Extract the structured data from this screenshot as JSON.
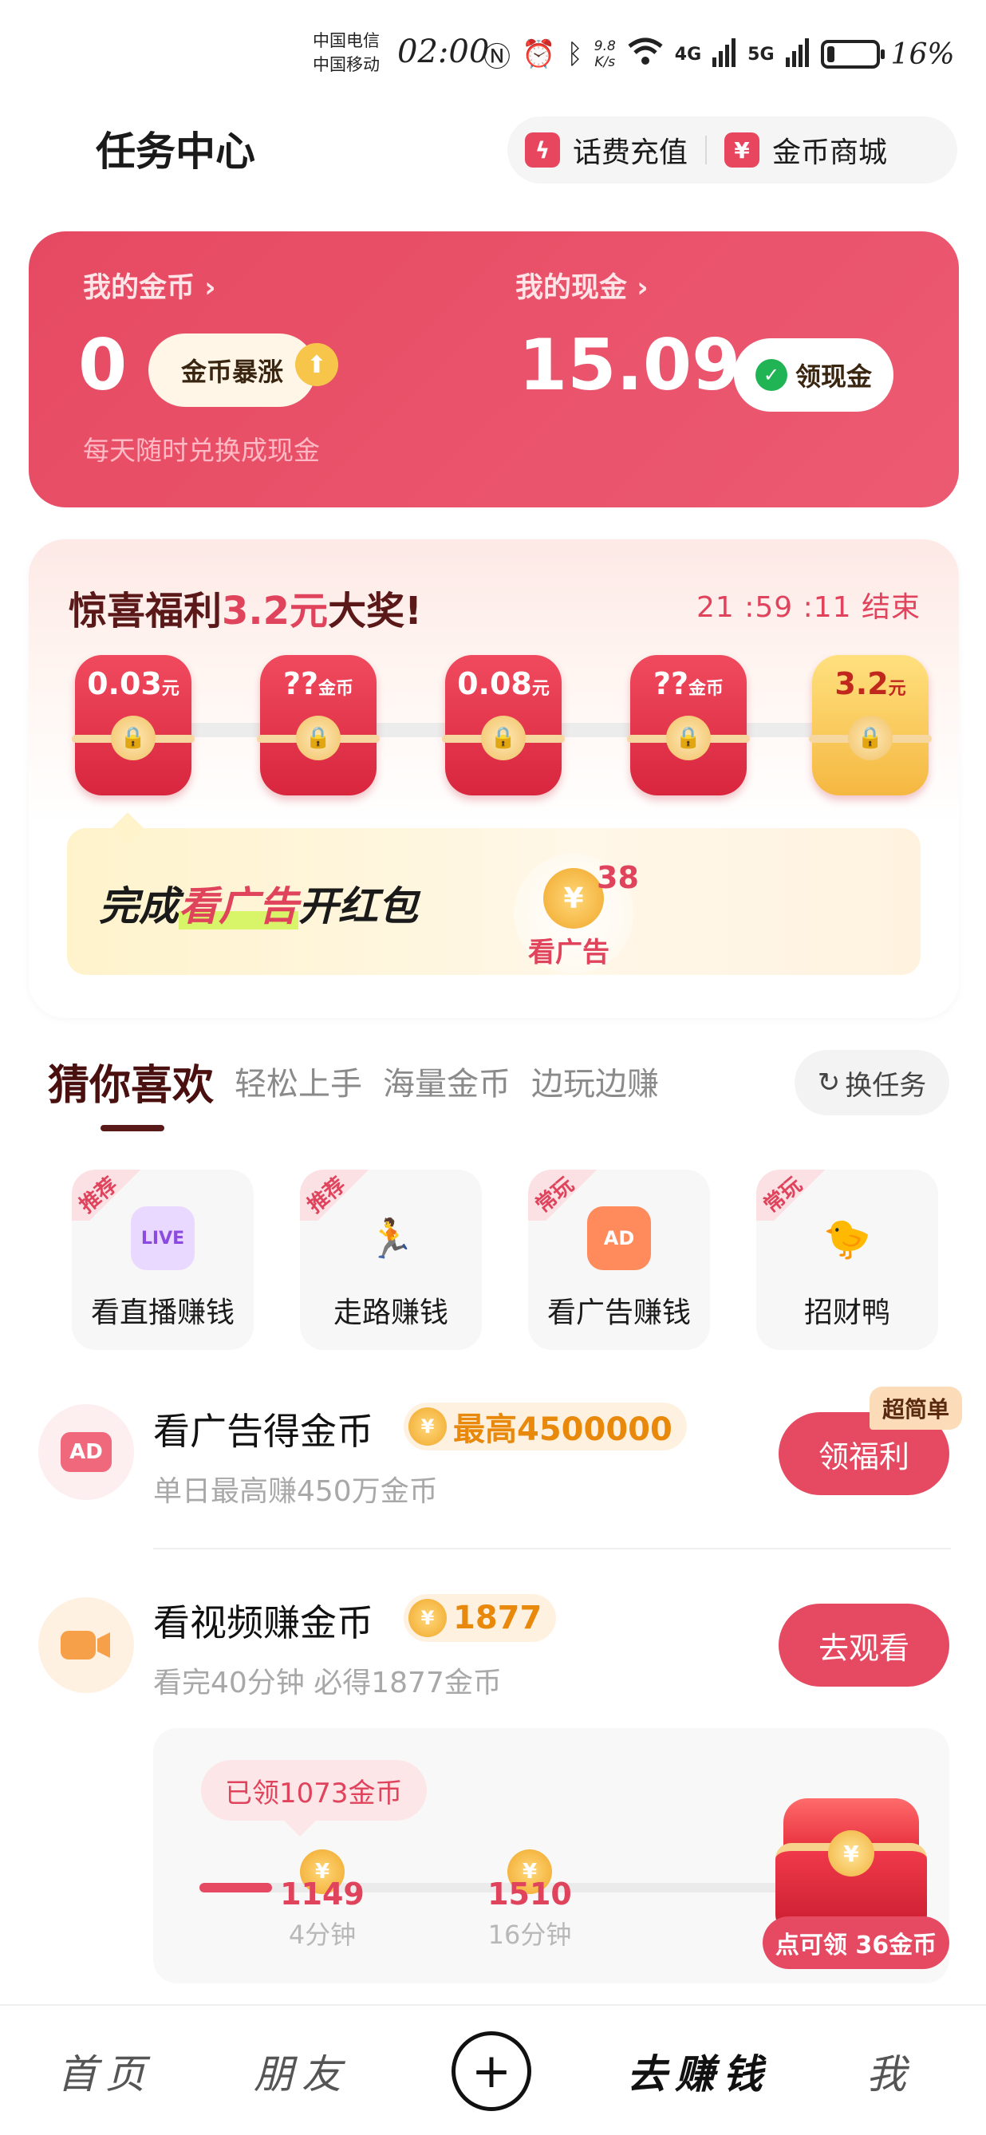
{
  "status_bar": {
    "carrier_1": "中国电信",
    "carrier_2": "中国移动",
    "time": "02:00",
    "speed_value": "9.8",
    "speed_unit": "K/s",
    "network_1": "4G",
    "network_2": "5G",
    "battery_percent": "16%",
    "battery_level": 0.16
  },
  "header": {
    "title": "任务中心",
    "actions": [
      {
        "label": "话费充值",
        "icon": "lightning-icon"
      },
      {
        "label": "金币商城",
        "icon": "yuan-ticket-icon"
      }
    ]
  },
  "coin_card": {
    "coins_label": "我的金币",
    "coins_value": "0",
    "coins_pill": "金币暴涨",
    "cash_label": "我的现金",
    "cash_value": "15.09",
    "cash_pill": "领现金",
    "subtext": "每天随时兑换成现金",
    "accent_color": "#e64a62"
  },
  "welfare": {
    "title_prefix": "惊喜福利",
    "title_highlight": "3.2元",
    "title_suffix": "大奖!",
    "timer": "21 :59 :11",
    "timer_suffix": "结束",
    "envelopes": [
      {
        "value": "0.03",
        "unit": "元",
        "gold": false
      },
      {
        "value": "??",
        "unit": "金币",
        "gold": false
      },
      {
        "value": "0.08",
        "unit": "元",
        "gold": false
      },
      {
        "value": "??",
        "unit": "金币",
        "gold": false
      },
      {
        "value": "3.2",
        "unit": "元",
        "gold": true
      }
    ],
    "banner_prefix": "完成",
    "banner_highlight": "看广告",
    "banner_suffix": "开红包",
    "ad_count": "38",
    "ad_label": "看广告"
  },
  "tabs": {
    "items": [
      "猜你喜欢",
      "轻松上手",
      "海量金币",
      "边玩边赚"
    ],
    "active_index": 0,
    "swap_label": "换任务"
  },
  "quick_items": [
    {
      "ribbon": "推荐",
      "label": "看直播赚钱",
      "icon": "live-tv-icon"
    },
    {
      "ribbon": "推荐",
      "label": "走路赚钱",
      "icon": "running-person-icon"
    },
    {
      "ribbon": "常玩",
      "label": "看广告赚钱",
      "icon": "ad-tv-icon"
    },
    {
      "ribbon": "常玩",
      "label": "招财鸭",
      "icon": "duck-icon"
    }
  ],
  "tasks": [
    {
      "title": "看广告得金币",
      "badge": "最高4500000",
      "sub": "单日最高赚450万金币",
      "button": "领福利",
      "tag": "超简单",
      "icon": "ad-icon",
      "icon_text": "AD"
    },
    {
      "title": "看视频赚金币",
      "badge": "1877",
      "sub": "看完40分钟 必得1877金币",
      "button": "去观看",
      "icon": "video-camera-icon"
    }
  ],
  "video_progress": {
    "claimed": "已领1073金币",
    "progress": 0.12,
    "milestones": [
      {
        "value": "1149",
        "time": "4分钟"
      },
      {
        "value": "1510",
        "time": "16分钟"
      }
    ],
    "chest_label": "点可领 36金币"
  },
  "bottom_nav": {
    "items": [
      "首页",
      "朋友",
      "去赚钱",
      "我"
    ],
    "active_index": 2,
    "plus_icon": "plus-circle-icon"
  }
}
